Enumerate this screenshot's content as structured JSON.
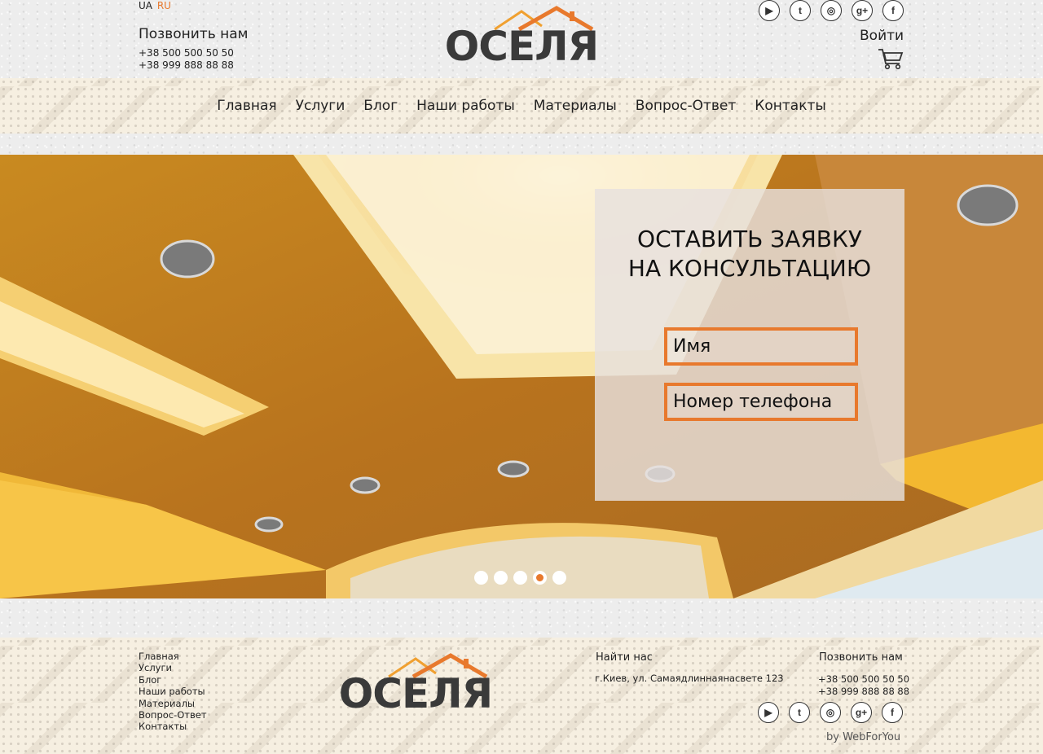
{
  "header": {
    "lang_ua": "UA",
    "lang_ru": "RU",
    "call_title": "Позвонить нам",
    "phones": [
      "+38 500 500 50 50",
      "+38 999 888 88 88"
    ],
    "logo_text": "ОСЕЛЯ",
    "login": "Войти",
    "social_icons": [
      "youtube-icon",
      "twitter-icon",
      "instagram-icon",
      "google-plus-icon",
      "facebook-icon"
    ]
  },
  "nav": {
    "items": [
      "Главная",
      "Услуги",
      "Блог",
      "Наши работы",
      "Материалы",
      "Вопрос-Ответ",
      "Контакты"
    ]
  },
  "hero": {
    "form_title_line1": "ОСТАВИТЬ ЗАЯВКУ",
    "form_title_line2": "НА КОНСУЛЬТАЦИЮ",
    "name_placeholder": "Имя",
    "phone_placeholder": "Номер телефона",
    "slider": {
      "count": 5,
      "active_index": 3
    }
  },
  "footer": {
    "links": [
      "Главная",
      "Услуги",
      "Блог",
      "Наши работы",
      "Материалы",
      "Вопрос-Ответ",
      "Контакты"
    ],
    "logo_text": "ОСЕЛЯ",
    "find_title": "Найти нас",
    "address": "г.Киев, ул. Самаядлиннаянасвете 123",
    "call_title": "Позвонить нам",
    "phones": [
      "+38 500 500 50 50",
      "+38 999 888 88 88"
    ],
    "credit": "by WebForYou"
  },
  "colors": {
    "accent": "#e8792d",
    "text": "#222222",
    "logo": "#3a3a3a"
  }
}
